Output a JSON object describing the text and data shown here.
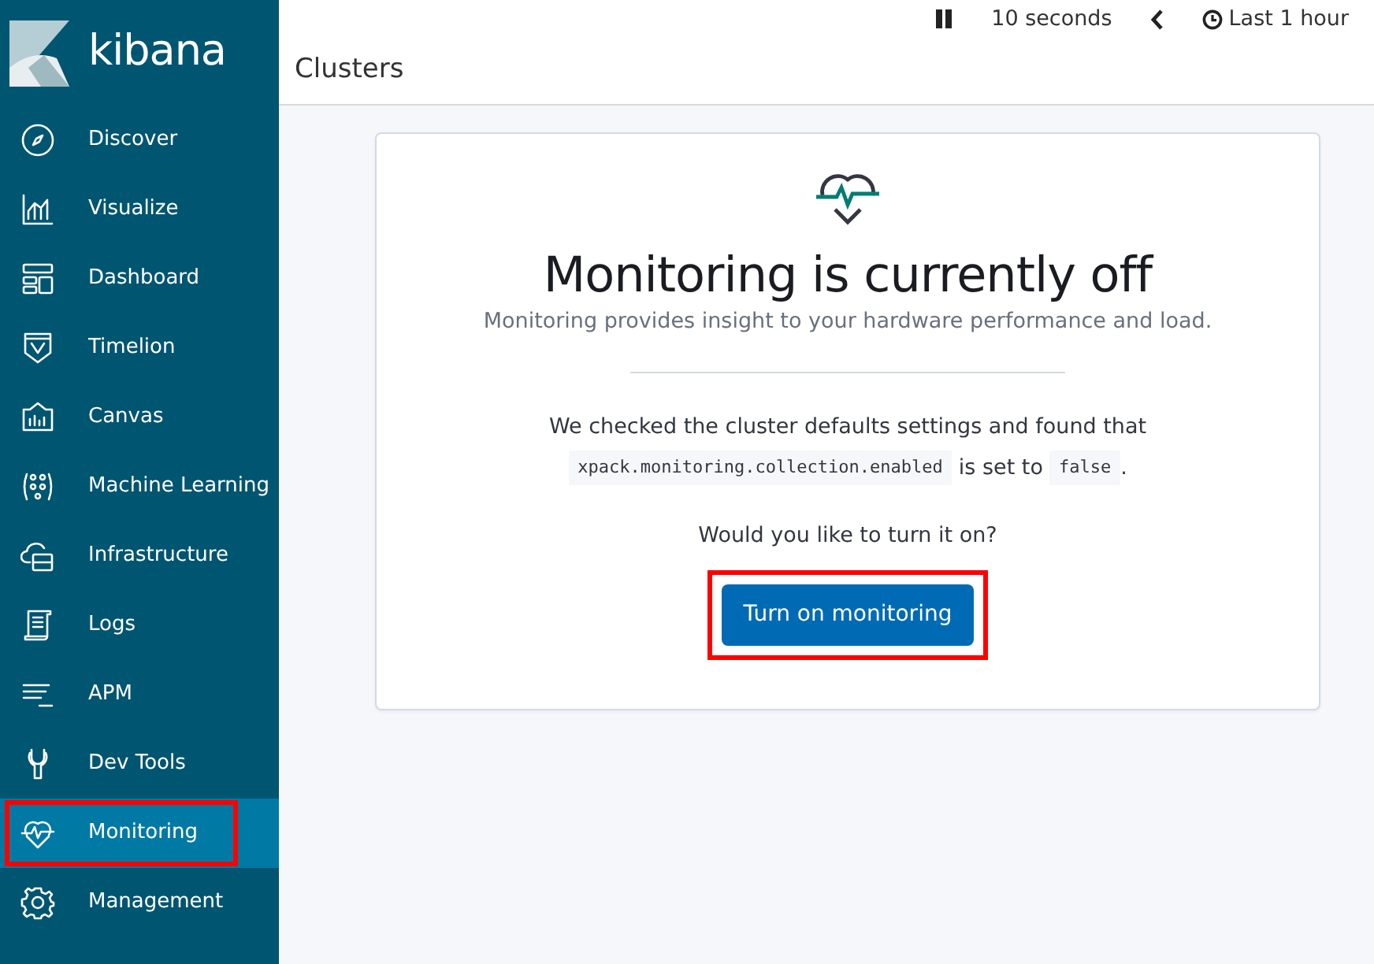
{
  "sidebar": {
    "logo": "kibana",
    "items": [
      {
        "label": "Discover",
        "selected": false,
        "annotated": false
      },
      {
        "label": "Visualize",
        "selected": false,
        "annotated": false
      },
      {
        "label": "Dashboard",
        "selected": false,
        "annotated": false
      },
      {
        "label": "Timelion",
        "selected": false,
        "annotated": false
      },
      {
        "label": "Canvas",
        "selected": false,
        "annotated": false
      },
      {
        "label": "Machine Learning",
        "selected": false,
        "annotated": false
      },
      {
        "label": "Infrastructure",
        "selected": false,
        "annotated": false
      },
      {
        "label": "Logs",
        "selected": false,
        "annotated": false
      },
      {
        "label": "APM",
        "selected": false,
        "annotated": false
      },
      {
        "label": "Dev Tools",
        "selected": false,
        "annotated": false
      },
      {
        "label": "Monitoring",
        "selected": true,
        "annotated": true
      },
      {
        "label": "Management",
        "selected": false,
        "annotated": false
      }
    ]
  },
  "top_bar": {
    "refresh_interval": "10 seconds",
    "time_range": "Last 1 hour"
  },
  "page_title": "Clusters",
  "panel": {
    "title": "Monitoring is currently off",
    "subtitle": "Monitoring provides insight to your hardware performance and load.",
    "check_message": {
      "lead": "We checked the cluster defaults settings and found that",
      "setting": "xpack.monitoring.collection.enabled",
      "middle": "is set to",
      "value": "false",
      "end": "."
    },
    "question": "Would you like to turn it on?",
    "button": {
      "label": "Turn on monitoring",
      "annotated": true
    }
  }
}
